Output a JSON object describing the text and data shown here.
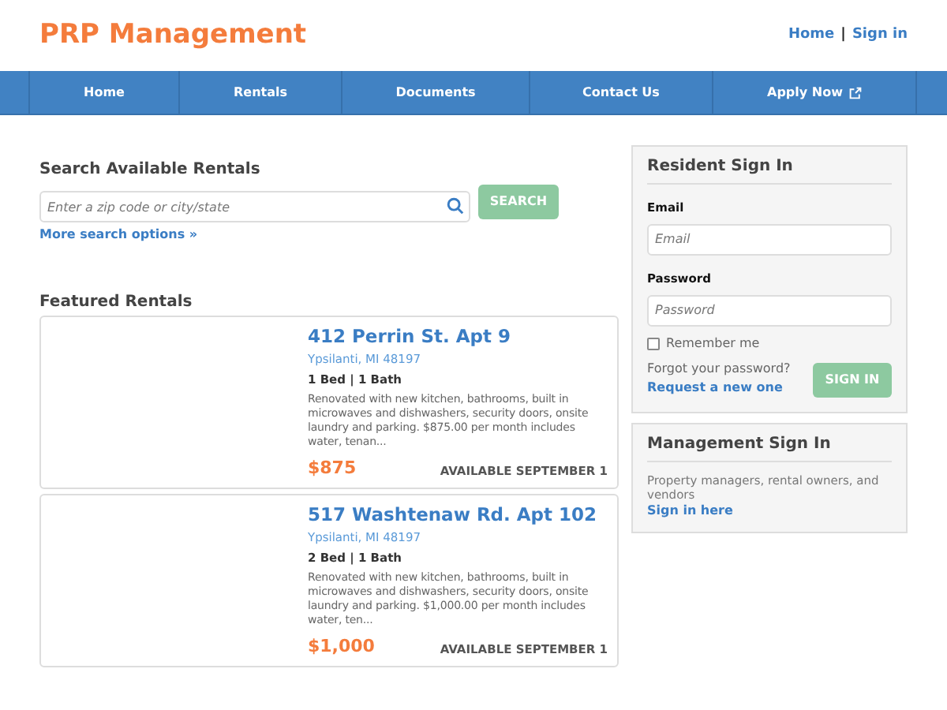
{
  "header": {
    "title": "PRP Management",
    "links": [
      "Home",
      "Sign in"
    ],
    "separator": "|"
  },
  "nav": [
    {
      "label": "Home",
      "external": false
    },
    {
      "label": "Rentals",
      "external": false
    },
    {
      "label": "Documents",
      "external": false
    },
    {
      "label": "Contact Us",
      "external": false
    },
    {
      "label": "Apply Now",
      "external": true
    }
  ],
  "search": {
    "heading": "Search Available Rentals",
    "placeholder": "Enter a zip code or city/state",
    "button": "SEARCH",
    "more_link": "More search options »"
  },
  "featured": {
    "heading": "Featured Rentals",
    "listings": [
      {
        "title": "412 Perrin St. Apt 9",
        "location": "Ypsilanti, MI 48197",
        "beds": "1 Bed | 1 Bath",
        "description": "Renovated with new kitchen, bathrooms, built in microwaves and dishwashers, security doors, onsite laundry and parking. $875.00 per month includes water, tenan...",
        "price": "$875",
        "availability": "AVAILABLE SEPTEMBER 1"
      },
      {
        "title": "517 Washtenaw Rd. Apt 102",
        "location": "Ypsilanti, MI 48197",
        "beds": "2 Bed | 1 Bath",
        "description": "Renovated with new kitchen, bathrooms, built in microwaves and dishwashers, security doors, onsite laundry and parking. $1,000.00 per month includes water, ten...",
        "price": "$1,000",
        "availability": "AVAILABLE SEPTEMBER 1"
      }
    ]
  },
  "resident_sign_in": {
    "heading": "Resident Sign In",
    "email_label": "Email",
    "email_placeholder": "Email",
    "password_label": "Password",
    "password_placeholder": "Password",
    "remember": {
      "label": "Remember me",
      "checked": false
    },
    "forgot_text": "Forgot your password?",
    "forgot_link": "Request a new one",
    "button": "SIGN IN"
  },
  "management_sign_in": {
    "heading": "Management Sign In",
    "text": "Property managers, rental owners, and vendors",
    "link": "Sign in here"
  }
}
